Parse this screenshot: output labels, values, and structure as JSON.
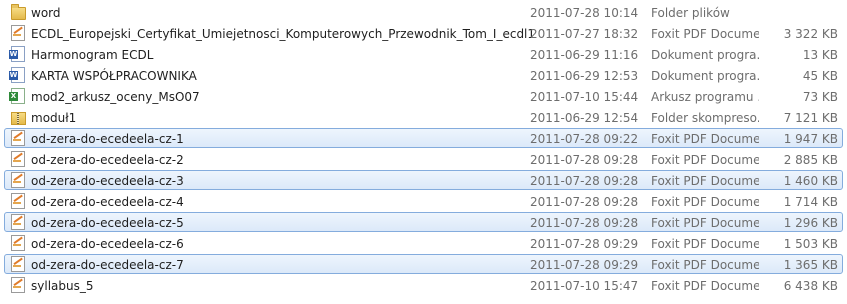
{
  "files": [
    {
      "name": "word",
      "date": "2011-07-28 10:14",
      "type": "Folder plików",
      "size": "",
      "icon": "folder-icon",
      "selected": false
    },
    {
      "name": "ECDL_Europejski_Certyfikat_Umiejetnosci_Komputerowych_Przewodnik_Tom_I_ecdl1",
      "date": "2011-07-27 18:32",
      "type": "Foxit PDF Docume...",
      "size": "3 322 KB",
      "icon": "pdf-icon",
      "selected": false
    },
    {
      "name": "Harmonogram ECDL",
      "date": "2011-06-29 11:16",
      "type": "Dokument progra...",
      "size": "13 KB",
      "icon": "word-doc-icon",
      "selected": false
    },
    {
      "name": "KARTA WSPÓŁPRACOWNIKA",
      "date": "2011-06-29 12:53",
      "type": "Dokument progra...",
      "size": "45 KB",
      "icon": "word-doc-icon",
      "selected": false
    },
    {
      "name": "mod2_arkusz_oceny_MsO07",
      "date": "2011-07-10 15:44",
      "type": "Arkusz programu ...",
      "size": "73 KB",
      "icon": "excel-icon",
      "selected": false
    },
    {
      "name": "moduł1",
      "date": "2011-06-29 12:54",
      "type": "Folder skompreso...",
      "size": "7 121 KB",
      "icon": "zip-folder-icon",
      "selected": false
    },
    {
      "name": "od-zera-do-ecedeela-cz-1",
      "date": "2011-07-28 09:22",
      "type": "Foxit PDF Docume...",
      "size": "1 947 KB",
      "icon": "pdf-icon",
      "selected": true
    },
    {
      "name": "od-zera-do-ecedeela-cz-2",
      "date": "2011-07-28 09:28",
      "type": "Foxit PDF Docume...",
      "size": "2 885 KB",
      "icon": "pdf-icon",
      "selected": false
    },
    {
      "name": "od-zera-do-ecedeela-cz-3",
      "date": "2011-07-28 09:28",
      "type": "Foxit PDF Docume...",
      "size": "1 460 KB",
      "icon": "pdf-icon",
      "selected": true
    },
    {
      "name": "od-zera-do-ecedeela-cz-4",
      "date": "2011-07-28 09:28",
      "type": "Foxit PDF Docume...",
      "size": "1 714 KB",
      "icon": "pdf-icon",
      "selected": false
    },
    {
      "name": "od-zera-do-ecedeela-cz-5",
      "date": "2011-07-28 09:28",
      "type": "Foxit PDF Docume...",
      "size": "1 296 KB",
      "icon": "pdf-icon",
      "selected": true
    },
    {
      "name": "od-zera-do-ecedeela-cz-6",
      "date": "2011-07-28 09:29",
      "type": "Foxit PDF Docume...",
      "size": "1 503 KB",
      "icon": "pdf-icon",
      "selected": false
    },
    {
      "name": "od-zera-do-ecedeela-cz-7",
      "date": "2011-07-28 09:29",
      "type": "Foxit PDF Docume...",
      "size": "1 365 KB",
      "icon": "pdf-icon",
      "selected": true
    },
    {
      "name": "syllabus_5",
      "date": "2011-07-10 15:47",
      "type": "Foxit PDF Docume...",
      "size": "6 438 KB",
      "icon": "pdf-icon",
      "selected": false
    }
  ],
  "colors": {
    "selection_fill": "#dce9f9",
    "selection_border": "#84acdd",
    "secondary_text": "#6d6d6d"
  }
}
